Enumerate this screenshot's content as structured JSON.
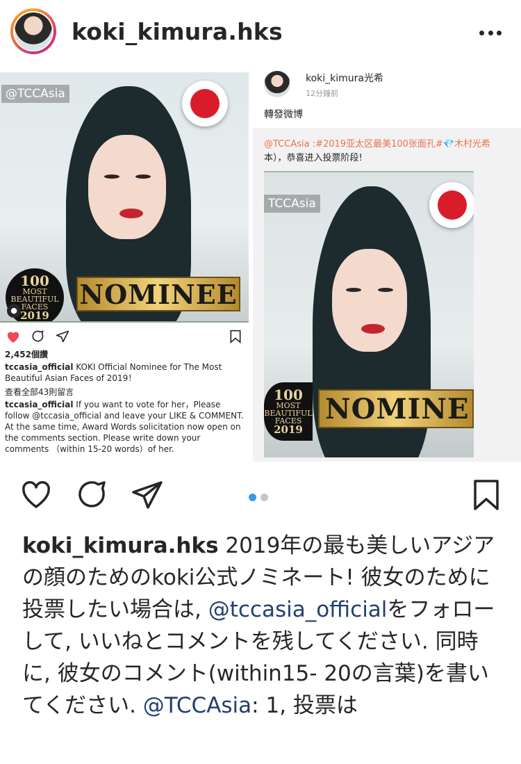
{
  "header": {
    "username": "koki_kimura.hks"
  },
  "embedded_left": {
    "tag": "@TCCAsia",
    "nominee_text": "NOMINEE",
    "badge": {
      "line1": "100",
      "line2": "MOST",
      "line3": "BEAUTIFUL",
      "line4": "FACES",
      "line5": "2019"
    },
    "likes": "2,452個讚",
    "caption_user": "tccasia_official",
    "caption_text": " KOKI Official Nominee for The Most Beautiful Asian Faces of 2019！",
    "view_comments": "查看全部43則留言",
    "comment_user": "tccasia_official",
    "comment_text": " If you want to vote for her，Please follow @tccasia_official and leave your LIKE & COMMENT. At the same time, Award Words solicitation now open on the comments section. Please write down your comments （within 15-20 words）of her."
  },
  "embedded_right": {
    "name": "koki_kimura光希",
    "time": "12分鐘前",
    "repost": "轉發微博",
    "quote_link": "@TCCAsia :#2019亚太区最美100张面孔#",
    "quote_tail": "💎木村光希",
    "quote_line2": "本），恭喜进入投票阶段!",
    "tag": "TCCAsia",
    "nominee_text": "NOMINE",
    "badge": {
      "line1": "100",
      "line2": "MOST",
      "line3": "BEAUTIFUL",
      "line4": "FACES",
      "line5": "2019"
    }
  },
  "carousel": {
    "count": 2,
    "active": 1,
    "active_color": "#3897f0",
    "inactive_color": "#c7c7c7"
  },
  "caption": {
    "username": "koki_kimura.hks",
    "part1": " 2019年の最も美しいアジアの顔のためのkoki公式ノミネート! 彼女のために投票したい場合は, ",
    "mention1": "@tccasia_official",
    "part2": "をフォローして, いいねとコメントを残してください. 同時に, 彼女のコメント(within15- 20の言葉)を書いてください. ",
    "mention2": "@TCCAsia",
    "part3": ": 1, 投票は"
  },
  "colors": {
    "like_red": "#ed4956",
    "text": "#262626",
    "mention": "#23406e"
  }
}
